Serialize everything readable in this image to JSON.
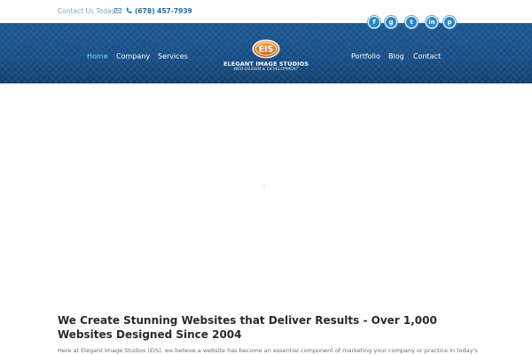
{
  "topbar": {
    "contact_text": "Contact Us Today!",
    "mail_icon": "envelope-icon",
    "phone_icon": "phone-icon",
    "phone_number": "(678) 457-7939"
  },
  "social": [
    {
      "name": "facebook",
      "glyph": "f"
    },
    {
      "name": "google-plus",
      "glyph": "g"
    },
    {
      "name": "twitter",
      "glyph": "t"
    },
    {
      "name": "linkedin",
      "glyph": "in"
    },
    {
      "name": "pinterest",
      "glyph": "p"
    }
  ],
  "nav": {
    "home": "Home",
    "company": "Company",
    "services": "Services",
    "portfolio": "Portfolio",
    "blog": "Blog",
    "contact": "Contact"
  },
  "logo": {
    "badge": "EIS",
    "title": "ELEGANT IMAGE STUDIOS",
    "subtitle": "WEB DESIGN & DEVELOPMENT"
  },
  "content": {
    "headline": "We Create Stunning Websites that Deliver Results - Over 1,000 Websites Designed Since 2004",
    "intro": "Here at Elegant Image Studios (EIS), we believe a website has become an essential component of marketing your company or practice in today's"
  },
  "colors": {
    "header_bg": "#164d86",
    "nav_active": "#79d3ff",
    "accent": "#2a86c8",
    "logo_orange": "#e07a1f"
  }
}
